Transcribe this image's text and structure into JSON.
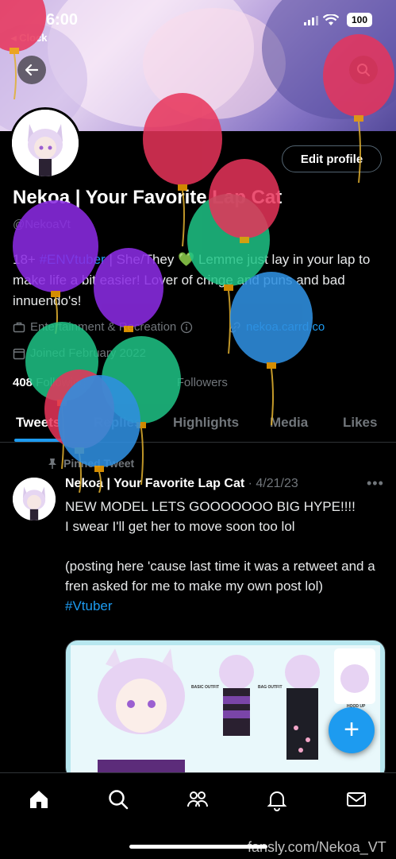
{
  "status_bar": {
    "time": "6:00",
    "back_app": "◂ Clock",
    "battery": "100"
  },
  "profile": {
    "edit_button": "Edit profile",
    "name": "Nekoa | Your Favorite Lap Cat",
    "handle": "@NekoaVt",
    "bio_pre": "18+ ",
    "bio_tag": "#ENVtuber",
    "bio_rest": " | She/They 💚 Lemme just lay in your lap to make life a bit easier! Lover of cringe and puns and bad innuendo's!",
    "category": "Entertainment & Recreation",
    "website": "nekoa.carrd.co",
    "joined": "Joined February 2022",
    "following_count": "408",
    "following_label": "Following",
    "followers_label": "Followers"
  },
  "tabs": [
    "Tweets",
    "Replies",
    "Highlights",
    "Media",
    "Likes"
  ],
  "pinned_label": "Pinned Tweet",
  "tweet": {
    "author": "Nekoa | Your Favorite Lap Cat",
    "date": "· 4/21/23",
    "body": "NEW MODEL LETS GOOOOOOO BIG HYPE!!!!\nI swear I'll get her to move soon too lol\n\n(posting here 'cause last time it was a retweet and a fren asked for me to make my own post lol)",
    "hashtag": "#Vtuber",
    "media_labels": [
      "BASIC OUTFIT",
      "BAG OUTFIT",
      "HOOD UP"
    ]
  },
  "fab_label": "+",
  "nav_icons": [
    "home-icon",
    "search-icon",
    "communities-icon",
    "notifications-icon",
    "messages-icon"
  ],
  "watermark": "fansly.com/Nekoa_VT",
  "colors": {
    "accent": "#1d9bf0",
    "background": "#000000",
    "muted": "#71767b"
  }
}
